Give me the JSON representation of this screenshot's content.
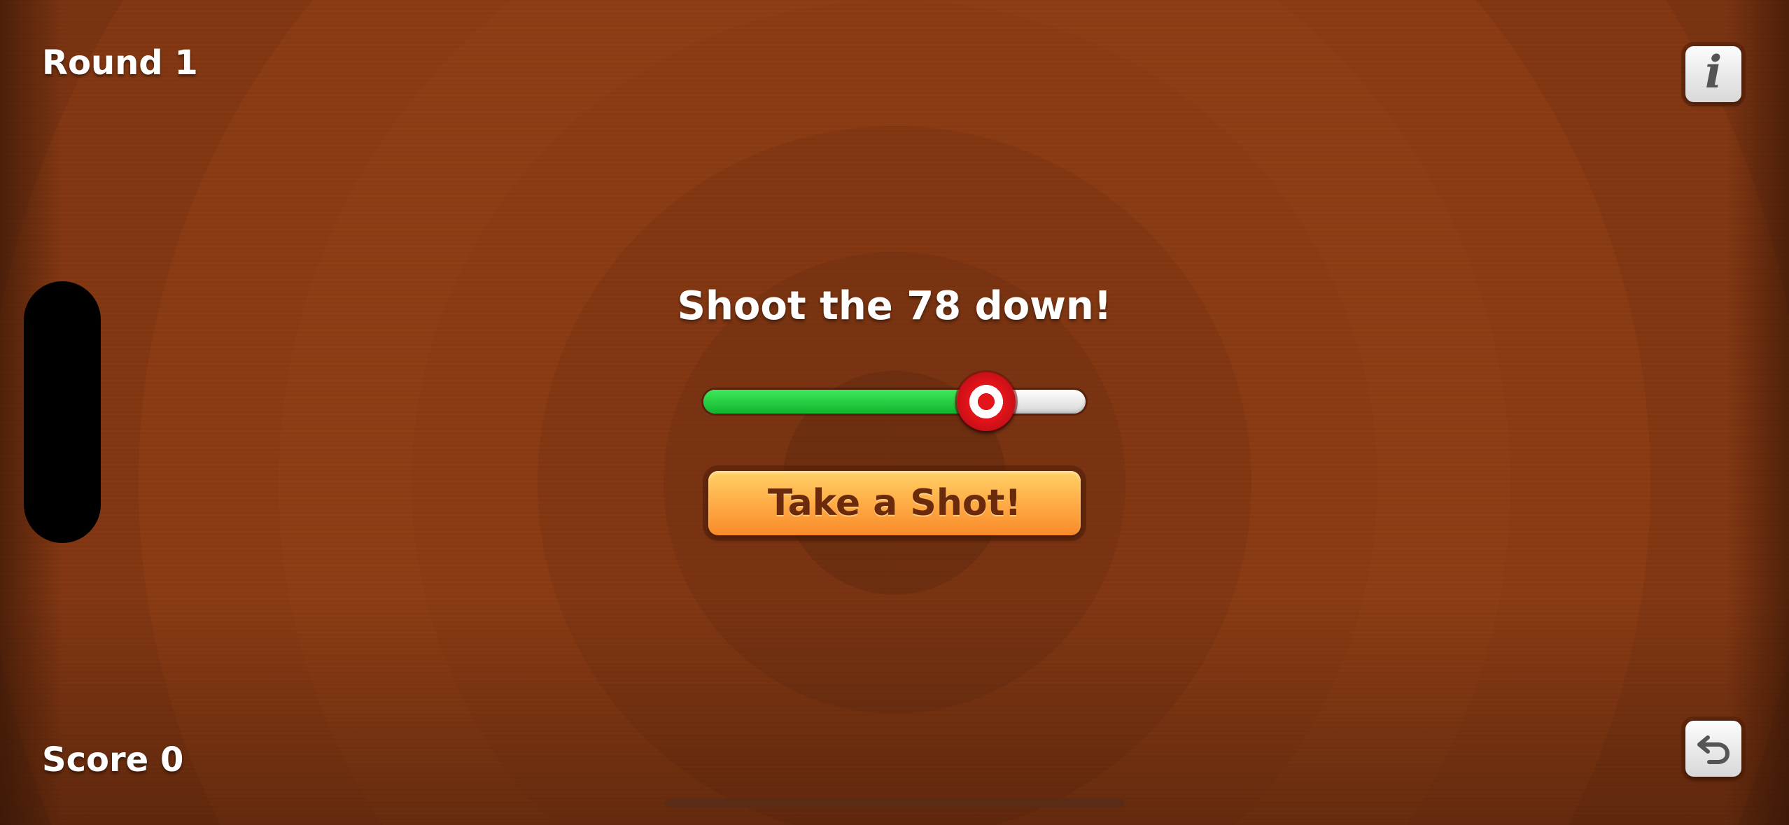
{
  "hud": {
    "round_label": "Round 1",
    "score_label": "Score 0"
  },
  "prompt": "Shoot the 78 down!",
  "slider": {
    "value_fraction": 0.74,
    "fill_color": "#1fcc3c",
    "track_color": "#e8e8e8",
    "thumb_style": "red-white bullseye"
  },
  "action_button": {
    "label": "Take a Shot!"
  },
  "buttons": {
    "info_glyph": "i",
    "info_icon": "info-icon",
    "undo_icon": "undo-arrow-icon"
  },
  "colors": {
    "background": "#8b3c14",
    "button_orange": "#ffb04a",
    "button_text": "#6b2a0c"
  }
}
